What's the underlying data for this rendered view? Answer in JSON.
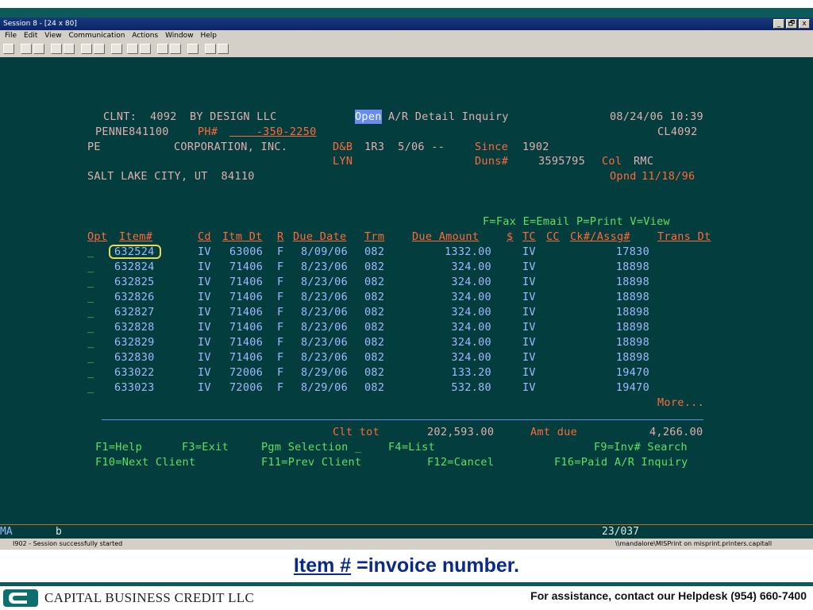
{
  "window": {
    "title": "Session 8 - [24 x 80]",
    "controls": [
      "_",
      "🗗",
      "x"
    ]
  },
  "menu": [
    "File",
    "Edit",
    "View",
    "Communication",
    "Actions",
    "Window",
    "Help"
  ],
  "header": {
    "client_label": "CLNT:",
    "client_no": "4092",
    "client_name": "BY DESIGN LLC",
    "status": "Open",
    "screen_title": "A/R Detail Inquiry",
    "datetime": "08/24/06 10:39",
    "account": "PENNE841100",
    "ph_label": "PH#",
    "phone": "    -350-2250",
    "cl_code": "CL4092",
    "debtor1": "PE",
    "debtor2": "CORPORATION, INC.",
    "db_label": "D&B",
    "db_values": "1R3  5/06 --",
    "since_label": "Since",
    "since_year": "1902",
    "lyn": "LYN",
    "duns_label": "Duns#",
    "duns": "3595795",
    "col_label": "Col",
    "col": "RMC",
    "city": "SALT LAKE CITY, UT  84110",
    "opnd_label": "Opnd",
    "opnd": "11/18/96"
  },
  "legend": "F=Fax E=Email P=Print V=View",
  "columns": [
    "Opt",
    "Item#",
    "Cd",
    "Itm Dt",
    "R",
    "Due Date",
    "Trm",
    "Due Amount",
    "$",
    "TC",
    "CC",
    "Ck#/Assg#",
    "Trans Dt"
  ],
  "rows": [
    {
      "opt": "_",
      "item": "632524",
      "cd": "IV",
      "itm_dt": "63006",
      "r": "F",
      "due_date": "8/09/06",
      "trm": "082",
      "amount": "1332.00",
      "tc": "IV",
      "ck": "17830"
    },
    {
      "opt": "_",
      "item": "632824",
      "cd": "IV",
      "itm_dt": "71406",
      "r": "F",
      "due_date": "8/23/06",
      "trm": "082",
      "amount": "324.00",
      "tc": "IV",
      "ck": "18898"
    },
    {
      "opt": "_",
      "item": "632825",
      "cd": "IV",
      "itm_dt": "71406",
      "r": "F",
      "due_date": "8/23/06",
      "trm": "082",
      "amount": "324.00",
      "tc": "IV",
      "ck": "18898"
    },
    {
      "opt": "_",
      "item": "632826",
      "cd": "IV",
      "itm_dt": "71406",
      "r": "F",
      "due_date": "8/23/06",
      "trm": "082",
      "amount": "324.00",
      "tc": "IV",
      "ck": "18898"
    },
    {
      "opt": "_",
      "item": "632827",
      "cd": "IV",
      "itm_dt": "71406",
      "r": "F",
      "due_date": "8/23/06",
      "trm": "082",
      "amount": "324.00",
      "tc": "IV",
      "ck": "18898"
    },
    {
      "opt": "_",
      "item": "632828",
      "cd": "IV",
      "itm_dt": "71406",
      "r": "F",
      "due_date": "8/23/06",
      "trm": "082",
      "amount": "324.00",
      "tc": "IV",
      "ck": "18898"
    },
    {
      "opt": "_",
      "item": "632829",
      "cd": "IV",
      "itm_dt": "71406",
      "r": "F",
      "due_date": "8/23/06",
      "trm": "082",
      "amount": "324.00",
      "tc": "IV",
      "ck": "18898"
    },
    {
      "opt": "_",
      "item": "632830",
      "cd": "IV",
      "itm_dt": "71406",
      "r": "F",
      "due_date": "8/23/06",
      "trm": "082",
      "amount": "324.00",
      "tc": "IV",
      "ck": "18898"
    },
    {
      "opt": "_",
      "item": "633022",
      "cd": "IV",
      "itm_dt": "72006",
      "r": "F",
      "due_date": "8/29/06",
      "trm": "082",
      "amount": "133.20",
      "tc": "IV",
      "ck": "19470"
    },
    {
      "opt": "_",
      "item": "633023",
      "cd": "IV",
      "itm_dt": "72006",
      "r": "F",
      "due_date": "8/29/06",
      "trm": "082",
      "amount": "532.80",
      "tc": "IV",
      "ck": "19470"
    }
  ],
  "more": "More...",
  "totals": {
    "clt_tot_label": "Clt tot",
    "clt_tot": "202,593.00",
    "amt_due_label": "Amt due",
    "amt_due": "4,266.00"
  },
  "fkeys1": {
    "help": "F1=Help",
    "exit": "F3=Exit",
    "pgm": "Pgm Selection _",
    "list": "F4=List",
    "search": "F9=Inv# Search"
  },
  "fkeys2": {
    "next": "F10=Next Client",
    "prev": "F11=Prev Client",
    "cancel": "F12=Cancel",
    "paid": "F16=Paid A/R Inquiry"
  },
  "statusbar": {
    "ma": "MA",
    "b": "b",
    "cursor": "23/037",
    "message": "I902 - Session successfully started",
    "printer": "\\\\mandalore\\MISPrint on misprint.printers.capitall"
  },
  "caption": {
    "em": "Item #",
    "rest": " =invoice number."
  },
  "footer": {
    "company": "CAPITAL BUSINESS CREDIT LLC",
    "help": "For assistance, contact our Helpdesk (954) 660-7400"
  }
}
